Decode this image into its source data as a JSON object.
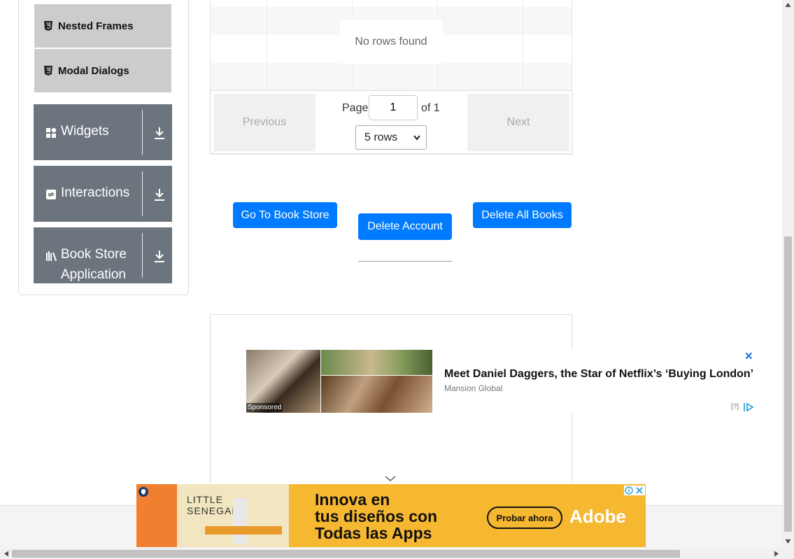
{
  "sidebar": {
    "sub_items": [
      {
        "label": "Nested Frames",
        "icon": "html5-icon"
      },
      {
        "label": "Modal Dialogs",
        "icon": "html5-icon"
      }
    ],
    "groups": [
      {
        "label": "Widgets",
        "icon": "widgets-icon"
      },
      {
        "label": "Interactions",
        "icon": "interactions-icon"
      },
      {
        "label": "Book Store Application",
        "icon": "books-icon"
      }
    ]
  },
  "table": {
    "empty_message": "No rows found",
    "pagination": {
      "previous_label": "Previous",
      "next_label": "Next",
      "page_label": "Page",
      "current_page": "1",
      "of_label": "of 1",
      "rows_selected": "5 rows"
    }
  },
  "actions": {
    "go_to_store": "Go To Book Store",
    "delete_account": "Delete Account",
    "delete_all_books": "Delete All Books"
  },
  "ad": {
    "headline": "Meet Daniel Daggers, the Star of Netflix’s ‘Buying London’",
    "source": "Mansion Global",
    "sponsored": "Sponsored",
    "close": "✕",
    "info": "[?]"
  },
  "banner": {
    "image_text_line1": "LITTLE",
    "image_text_line2": "SENEGAL",
    "headline_line1": "Innova en",
    "headline_line2": "tus diseños con",
    "headline_line3": "Todas las Apps",
    "cta": "Probar ahora",
    "brand": "Adobe"
  },
  "colors": {
    "primary": "#007bff",
    "sidebar_group": "#6c757d",
    "sidebar_item": "#cccccc",
    "banner": "#f6b731"
  }
}
